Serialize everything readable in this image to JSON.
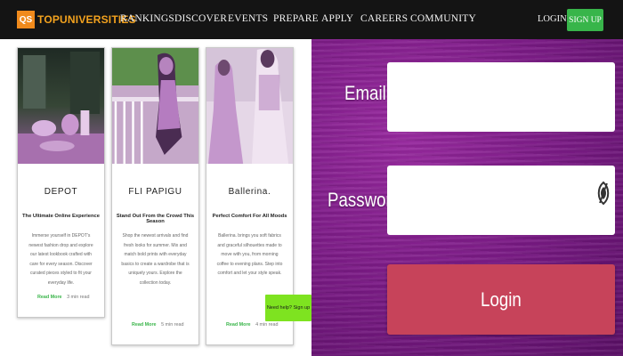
{
  "header": {
    "logo_mark": "QS",
    "logo_text": "TOPUNIVERSITIES",
    "nav": [
      "RANKINGS",
      "DISCOVER",
      "EVENTS",
      "PREPARE",
      "APPLY",
      "CAREERS",
      "COMMUNITY"
    ],
    "login": "LOGIN",
    "signup": "SIGN UP",
    "colors": {
      "bar": "#141414",
      "logo": "#f08a1c",
      "signup": "#38b54a"
    }
  },
  "cards": [
    {
      "title": "DEPOT",
      "subtitle": "The Ultimate Online Experience",
      "description": "Immerse yourself in DEPOT's newest fashion drop and explore our latest lookbook crafted with care for every season. Discover curated pieces styled to fit your everyday life.",
      "link": "Read More",
      "meta": "3 min read"
    },
    {
      "title": "FLI PAPIGU",
      "subtitle": "Stand Out From the Crowd This Season",
      "description": "Shop the newest arrivals and find fresh looks for summer. Mix and match bold prints with everyday basics to create a wardrobe that is uniquely yours. Explore the collection today.",
      "link": "Read More",
      "meta": "5 min read"
    },
    {
      "title": "Ballerina.",
      "subtitle": "Perfect Comfort For All Moods",
      "description": "Ballerina. brings you soft fabrics and graceful silhouettes made to move with you, from morning coffee to evening plans. Step into comfort and let your style speak.",
      "link": "Read More",
      "meta": "4 min read"
    }
  ],
  "floating_badge": "Need help? Sign up",
  "login_form": {
    "email_label": "Email",
    "email_value": "",
    "password_label": "Password",
    "password_value": "",
    "button_label": "Login",
    "colors": {
      "background": "#7a1a85",
      "button": "#c7435a"
    }
  }
}
